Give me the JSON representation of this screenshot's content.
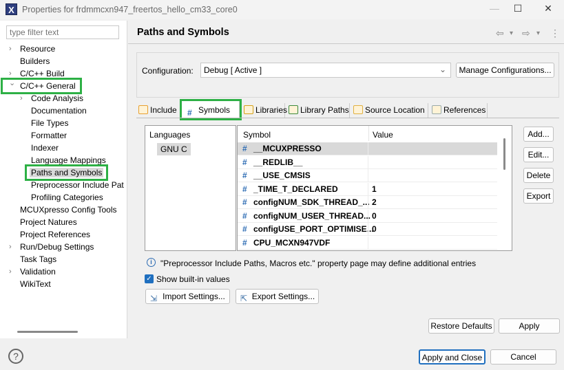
{
  "window": {
    "title": "Properties for frdmmcxn947_freertos_hello_cm33_core0",
    "app_icon": "X",
    "minimize": "—",
    "maximize": "☐",
    "close": "✕"
  },
  "sidebar": {
    "filter_placeholder": "type filter text",
    "items": [
      {
        "label": "Resource",
        "twisty": ">"
      },
      {
        "label": "Builders",
        "twisty": ""
      },
      {
        "label": "C/C++ Build",
        "twisty": ">"
      },
      {
        "label": "C/C++ General",
        "twisty": "v"
      },
      {
        "label": "Code Analysis",
        "twisty": ">"
      },
      {
        "label": "Documentation",
        "twisty": ""
      },
      {
        "label": "File Types",
        "twisty": ""
      },
      {
        "label": "Formatter",
        "twisty": ""
      },
      {
        "label": "Indexer",
        "twisty": ""
      },
      {
        "label": "Language Mappings",
        "twisty": ""
      },
      {
        "label": "Paths and Symbols",
        "twisty": ""
      },
      {
        "label": "Preprocessor Include Pat",
        "twisty": ""
      },
      {
        "label": "Profiling Categories",
        "twisty": ""
      },
      {
        "label": "MCUXpresso Config Tools",
        "twisty": ""
      },
      {
        "label": "Project Natures",
        "twisty": ""
      },
      {
        "label": "Project References",
        "twisty": ""
      },
      {
        "label": "Run/Debug Settings",
        "twisty": ">"
      },
      {
        "label": "Task Tags",
        "twisty": ""
      },
      {
        "label": "Validation",
        "twisty": ">"
      },
      {
        "label": "WikiText",
        "twisty": ""
      }
    ]
  },
  "page": {
    "title": "Paths and Symbols",
    "nav_back": "⇦",
    "nav_fwd": "⇨",
    "nav_menu": "▾",
    "more": "⋮",
    "configuration_label": "Configuration:",
    "configuration_value": "Debug  [ Active ]",
    "manage_button": "Manage Configurations...",
    "tabs": [
      "Include",
      "Symbols",
      "Libraries",
      "Library Paths",
      "Source Location",
      "References"
    ],
    "languages_header": "Languages",
    "languages": [
      "GNU C"
    ],
    "columns": [
      "Symbol",
      "Value"
    ],
    "symbols": [
      {
        "name": "__MCUXPRESSO",
        "value": ""
      },
      {
        "name": "__REDLIB__",
        "value": ""
      },
      {
        "name": "__USE_CMSIS",
        "value": ""
      },
      {
        "name": "_TIME_T_DECLARED",
        "value": "1"
      },
      {
        "name": "configNUM_SDK_THREAD_...",
        "value": "2"
      },
      {
        "name": "configNUM_USER_THREAD...",
        "value": "0"
      },
      {
        "name": "configUSE_PORT_OPTIMISE...",
        "value": "0"
      },
      {
        "name": "CPU_MCXN947VDF",
        "value": ""
      }
    ],
    "side_buttons": [
      "Add...",
      "Edit...",
      "Delete",
      "Export"
    ],
    "info": "\"Preprocessor Include Paths, Macros etc.\" property page may define additional entries",
    "show_builtin": "Show built-in values",
    "import_button": "Import Settings...",
    "export_button": "Export Settings...",
    "restore_button": "Restore Defaults",
    "apply_button": "Apply"
  },
  "footer": {
    "help": "?",
    "apply_close": "Apply and Close",
    "cancel": "Cancel"
  }
}
